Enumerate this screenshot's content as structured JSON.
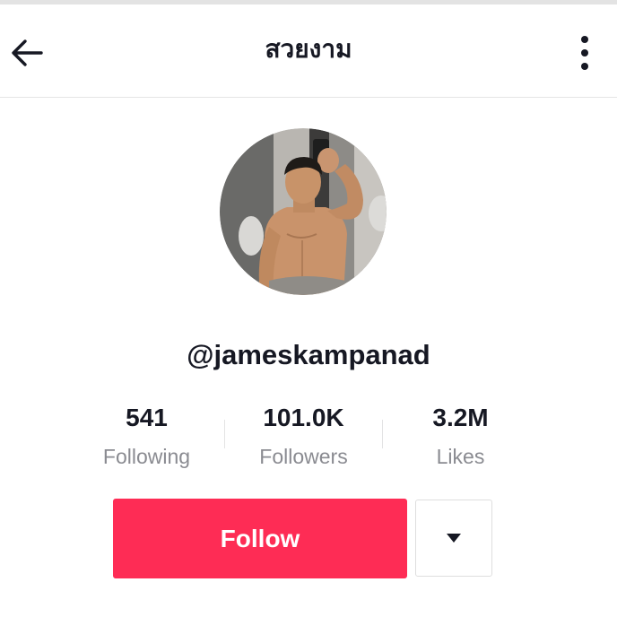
{
  "header": {
    "title": "สวยงาม",
    "back_icon": "arrow-left-icon",
    "more_icon": "vertical-dots-icon"
  },
  "profile": {
    "username": "@jameskampanad",
    "avatar_icon": "profile-photo"
  },
  "stats": [
    {
      "value": "541",
      "label": "Following"
    },
    {
      "value": "101.0K",
      "label": "Followers"
    },
    {
      "value": "3.2M",
      "label": "Likes"
    }
  ],
  "actions": {
    "follow_label": "Follow",
    "dropdown_icon": "caret-down-icon"
  },
  "colors": {
    "accent": "#fe2c55",
    "text_primary": "#161823",
    "text_secondary": "#8a8b91"
  }
}
